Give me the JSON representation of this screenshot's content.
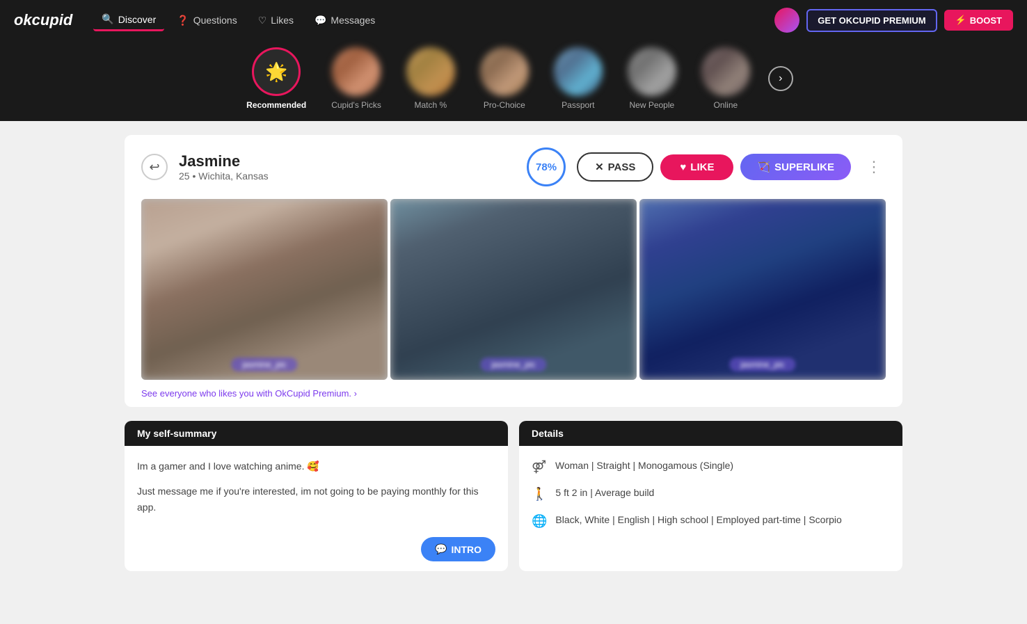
{
  "brand": {
    "logo": "okcupid"
  },
  "nav": {
    "links": [
      {
        "id": "discover",
        "label": "Discover",
        "icon": "🔍",
        "active": true
      },
      {
        "id": "questions",
        "label": "Questions",
        "icon": "❓",
        "active": false
      },
      {
        "id": "likes",
        "label": "Likes",
        "icon": "♡",
        "active": false
      },
      {
        "id": "messages",
        "label": "Messages",
        "icon": "💬",
        "active": false
      }
    ],
    "premium_btn": "GET OKCUPID PREMIUM",
    "boost_btn": "BOOST"
  },
  "categories": [
    {
      "id": "recommended",
      "label": "Recommended",
      "active": true,
      "icon": "☀"
    },
    {
      "id": "cupids-picks",
      "label": "Cupid's Picks",
      "active": false
    },
    {
      "id": "match",
      "label": "Match %",
      "active": false
    },
    {
      "id": "pro-choice",
      "label": "Pro-Choice",
      "active": false
    },
    {
      "id": "passport",
      "label": "Passport",
      "active": false
    },
    {
      "id": "new-people",
      "label": "New People",
      "active": false
    },
    {
      "id": "online",
      "label": "Online",
      "active": false
    }
  ],
  "profile": {
    "name": "Jasmine",
    "age": "25",
    "location": "Wichita, Kansas",
    "match_pct": "78%",
    "actions": {
      "pass": "PASS",
      "like": "LIKE",
      "superlike": "SUPERLIKE"
    },
    "premium_cta": "See everyone who likes you with OkCupid Premium.",
    "self_summary": {
      "header": "My self-summary",
      "p1": "Im a gamer and I love watching anime. 🥰",
      "p2": "Just message me if you're interested, im not going to be paying monthly for this app."
    },
    "details": {
      "header": "Details",
      "row1": "Woman | Straight | Monogamous (Single)",
      "row2": "5 ft 2 in | Average build",
      "row3": "Black, White | English | High school | Employed part-time | Scorpio"
    },
    "intro_btn": "INTRO"
  }
}
